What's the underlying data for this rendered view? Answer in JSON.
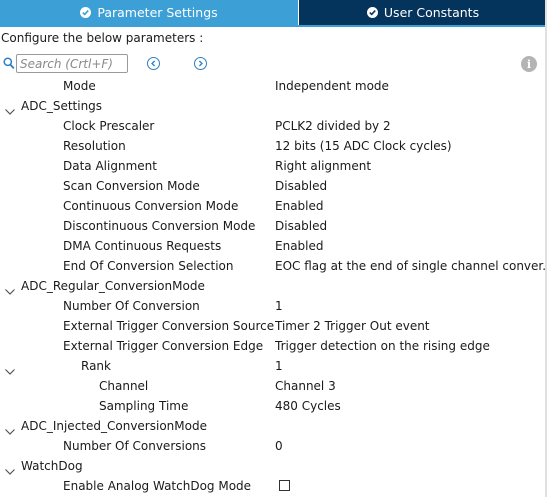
{
  "tabs": [
    {
      "label": "Parameter Settings",
      "active": true
    },
    {
      "label": "User Constants",
      "active": false
    }
  ],
  "colors": {
    "active_tab": "#3c9fd6",
    "inactive_tab": "#04335c",
    "nav_icon": "#2d7fc1"
  },
  "configure_text": "Configure the below parameters :",
  "search": {
    "placeholder": "Search (Crtl+F)",
    "value": ""
  },
  "icons": {
    "search": "search-icon",
    "prev": "chevron-left-circle-icon",
    "next": "chevron-right-circle-icon",
    "info": "info-icon",
    "expand": "chevron-down-icon"
  },
  "tree": [
    {
      "type": "param",
      "depth": 1,
      "label": "Mode",
      "value": "Independent mode"
    },
    {
      "type": "group",
      "depth": 0,
      "label": "ADC_Settings"
    },
    {
      "type": "param",
      "depth": 1,
      "label": "Clock Prescaler",
      "value": "PCLK2 divided by 2"
    },
    {
      "type": "param",
      "depth": 1,
      "label": "Resolution",
      "value": "12 bits (15 ADC Clock cycles)"
    },
    {
      "type": "param",
      "depth": 1,
      "label": "Data Alignment",
      "value": "Right alignment"
    },
    {
      "type": "param",
      "depth": 1,
      "label": "Scan Conversion Mode",
      "value": "Disabled"
    },
    {
      "type": "param",
      "depth": 1,
      "label": "Continuous Conversion Mode",
      "value": "Enabled"
    },
    {
      "type": "param",
      "depth": 1,
      "label": "Discontinuous Conversion Mode",
      "value": "Disabled"
    },
    {
      "type": "param",
      "depth": 1,
      "label": "DMA Continuous Requests",
      "value": "Enabled"
    },
    {
      "type": "param",
      "depth": 1,
      "label": "End Of Conversion Selection",
      "value": "EOC flag at the end of single channel conver..."
    },
    {
      "type": "group",
      "depth": 0,
      "label": "ADC_Regular_ConversionMode"
    },
    {
      "type": "param",
      "depth": 1,
      "label": "Number Of Conversion",
      "value": "1"
    },
    {
      "type": "param",
      "depth": 1,
      "label": "External Trigger Conversion Source",
      "value": "Timer 2 Trigger Out event"
    },
    {
      "type": "param",
      "depth": 1,
      "label": "External Trigger Conversion Edge",
      "value": "Trigger detection on the rising edge"
    },
    {
      "type": "subgroup",
      "depth": 2,
      "label": "Rank",
      "value": "1"
    },
    {
      "type": "param",
      "depth": 3,
      "label": "Channel",
      "value": "Channel 3"
    },
    {
      "type": "param",
      "depth": 3,
      "label": "Sampling Time",
      "value": "480 Cycles"
    },
    {
      "type": "group",
      "depth": 0,
      "label": "ADC_Injected_ConversionMode"
    },
    {
      "type": "param",
      "depth": 1,
      "label": "Number Of Conversions",
      "value": "0"
    },
    {
      "type": "group",
      "depth": 0,
      "label": "WatchDog"
    },
    {
      "type": "checkbox",
      "depth": 1,
      "label": "Enable Analog WatchDog Mode",
      "checked": false
    }
  ]
}
